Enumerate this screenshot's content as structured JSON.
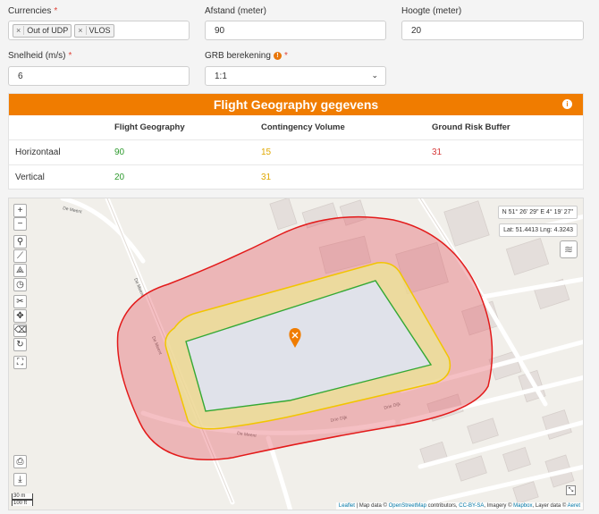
{
  "form": {
    "currencies": {
      "label": "Currencies",
      "required": "*",
      "tags": [
        "Out of UDP",
        "VLOS"
      ]
    },
    "afstand": {
      "label": "Afstand (meter)",
      "value": "90"
    },
    "hoogte": {
      "label": "Hoogte (meter)",
      "value": "20"
    },
    "snelheid": {
      "label": "Snelheid (m/s)",
      "required": "*",
      "value": "6"
    },
    "grb": {
      "label": "GRB berekening",
      "required": "*",
      "info": "!",
      "value": "1:1"
    }
  },
  "panel": {
    "title": "Flight Geography gegevens",
    "info": "i",
    "columns": [
      "",
      "Flight Geography",
      "Contingency Volume",
      "Ground Risk Buffer"
    ],
    "rows": [
      {
        "label": "Horizontaal",
        "fg": "90",
        "cv": "15",
        "grb": "31"
      },
      {
        "label": "Vertical",
        "fg": "20",
        "cv": "31",
        "grb": ""
      }
    ],
    "colors": {
      "header": "#f07c00",
      "flight_geography": "#2e9a2e",
      "contingency": "#e0a800",
      "ground_risk": "#d63a3a"
    }
  },
  "map": {
    "zoom_in": "+",
    "zoom_out": "−",
    "coords_dms": "N 51° 26' 29\" E 4° 19' 27\"",
    "coords_dec": "Lat: 51.4413 Lng: 4.3243",
    "scale_m": "30 m",
    "scale_ft": "100 ft",
    "attribution": {
      "leaflet": "Leaflet",
      "sep1": " | Map data © ",
      "osm": "OpenStreetMap",
      "mid": " contributors, ",
      "ccbysa": "CC-BY-SA",
      "imagery": ", Imagery © ",
      "mapbox": "Mapbox",
      "layer": ", Layer data © ",
      "aeret": "Aeret"
    },
    "street_labels": [
      "De Meent",
      "De Meent",
      "De Meent",
      "De Meent",
      "Drie Dijk",
      "Drie Dijk"
    ]
  }
}
